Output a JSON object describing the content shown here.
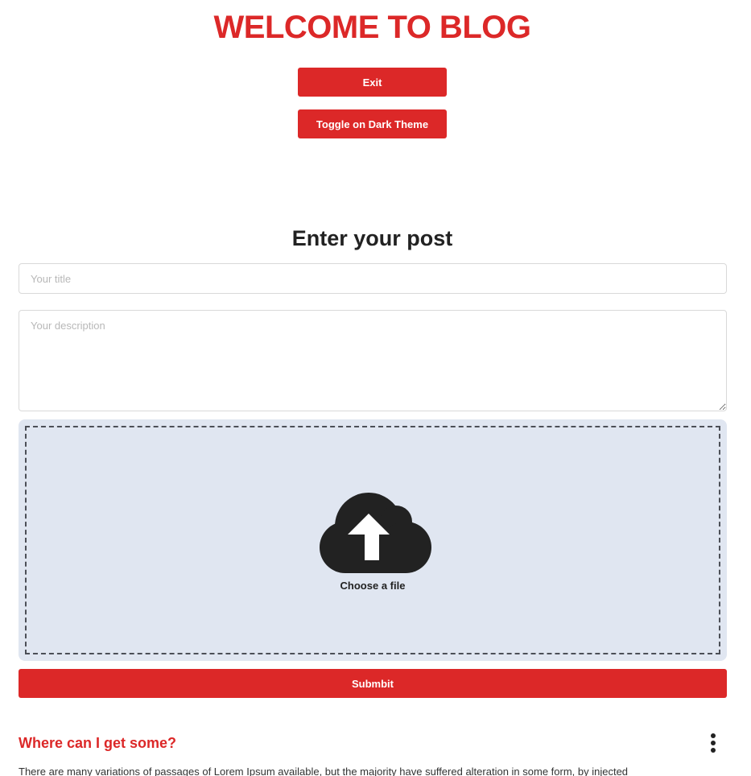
{
  "header": {
    "title": "WELCOME TO BLOG",
    "exit_label": "Exit",
    "theme_toggle_label": "Toggle on Dark Theme"
  },
  "form": {
    "heading": "Enter your post",
    "title_placeholder": "Your title",
    "title_value": "",
    "description_placeholder": "Your description",
    "description_value": "",
    "upload_label": "Choose a file",
    "upload_icon": "cloud-upload-icon",
    "submit_label": "Submbit"
  },
  "posts": [
    {
      "title": "Where can I get some?",
      "body": "There are many variations of passages of Lorem Ipsum available, but the majority have suffered alteration in some form, by injected"
    }
  ],
  "colors": {
    "accent": "#dc2828",
    "upload_bg": "#e0e6f1",
    "text_dark": "#222222"
  }
}
